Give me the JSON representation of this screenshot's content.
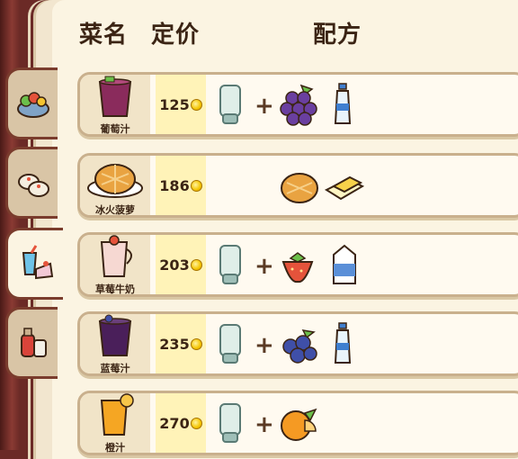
{
  "header": {
    "name": "菜名",
    "price": "定价",
    "recipe": "配方"
  },
  "tabs": [
    {
      "name": "salad-tab",
      "icon": "salad-bowl-icon",
      "active": false
    },
    {
      "name": "dimsum-tab",
      "icon": "dim-sum-icon",
      "active": false
    },
    {
      "name": "drinks-tab",
      "icon": "drink-cake-icon",
      "active": true
    },
    {
      "name": "condiments-tab",
      "icon": "sauce-bottles-icon",
      "active": false
    }
  ],
  "recipes": [
    {
      "name": "葡萄汁",
      "price": "125",
      "ingredients": [
        "blender",
        "grapes",
        "water-bottle"
      ],
      "drink_color": "#8a2b5c"
    },
    {
      "name": "冰火菠萝",
      "price": "186",
      "ingredients": [
        "pineapple-bun",
        "butter"
      ]
    },
    {
      "name": "草莓牛奶",
      "price": "203",
      "ingredients": [
        "blender",
        "strawberries",
        "milk"
      ],
      "drink_color": "#f6d8d2"
    },
    {
      "name": "蓝莓汁",
      "price": "235",
      "ingredients": [
        "blender",
        "blueberries",
        "water-bottle"
      ],
      "drink_color": "#4a1f5a"
    },
    {
      "name": "橙汁",
      "price": "270",
      "ingredients": [
        "blender",
        "orange"
      ],
      "drink_color": "#f5a623"
    }
  ],
  "plus_symbol": "+"
}
